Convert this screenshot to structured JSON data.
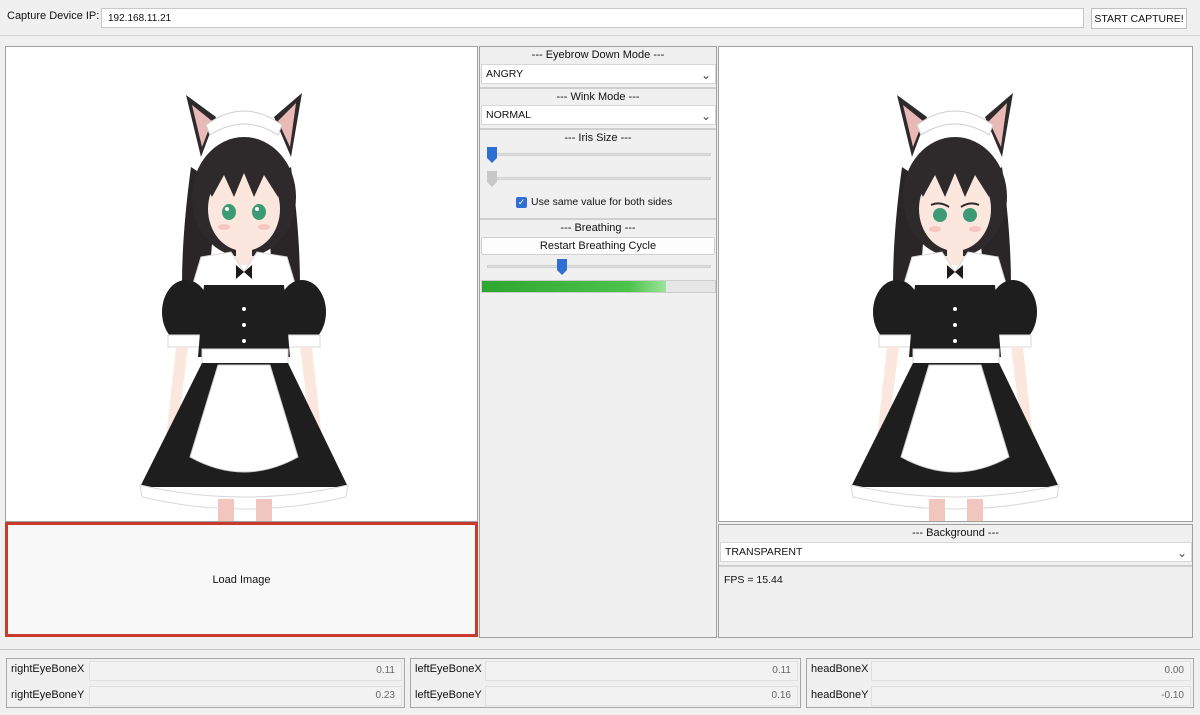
{
  "topbar": {
    "ip_label": "Capture Device IP:",
    "ip_value": "192.168.11.21",
    "start_button": "START CAPTURE!"
  },
  "left_panel": {
    "load_image_label": "Load Image"
  },
  "controls": {
    "eyebrow": {
      "title": "--- Eyebrow Down Mode ---",
      "value": "ANGRY"
    },
    "wink": {
      "title": "--- Wink Mode ---",
      "value": "NORMAL"
    },
    "iris": {
      "title": "--- Iris Size ---",
      "left_value": 0.0,
      "right_value": 0.0,
      "same_value_checked": true,
      "same_value_label": "Use same value for both sides"
    },
    "breathing": {
      "title": "--- Breathing ---",
      "restart_label": "Restart Breathing Cycle",
      "slider_value": 0.35,
      "progress": 0.79
    }
  },
  "right_panel": {
    "background_title": "--- Background ---",
    "background_value": "TRANSPARENT",
    "fps_text": "FPS = 15.44"
  },
  "metrics": [
    {
      "label_x": "rightEyeBoneX",
      "value_x": "0.11",
      "label_y": "rightEyeBoneY",
      "value_y": "0.23"
    },
    {
      "label_x": "leftEyeBoneX",
      "value_x": "0.11",
      "label_y": "leftEyeBoneY",
      "value_y": "0.16"
    },
    {
      "label_x": "headBoneX",
      "value_x": "0.00",
      "label_y": "headBoneY",
      "value_y": "-0.10"
    }
  ],
  "colors": {
    "accent_blue": "#2f6fd1",
    "progress_green": "#3fbf3f",
    "load_border": "#c93a2d"
  }
}
